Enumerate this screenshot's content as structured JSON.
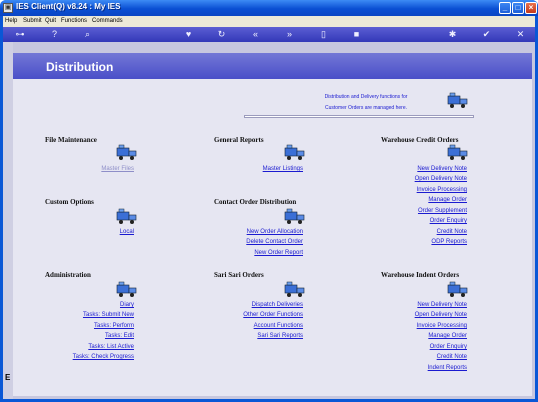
{
  "window": {
    "title": "IES Client(Q) v8.24 : My IES"
  },
  "menubar": {
    "items": [
      "Help",
      "Submit",
      "Quit",
      "Functions",
      "Commands"
    ]
  },
  "toolbar": {
    "icons": [
      "key-icon",
      "help-icon",
      "search-icon",
      "heart-icon",
      "refresh-icon",
      "rewind-icon",
      "fast-forward-icon",
      "document-icon",
      "stop-icon",
      "world-icon",
      "check-icon",
      "close-icon"
    ]
  },
  "header": {
    "title": "Distribution"
  },
  "intro": {
    "line1": "Distribution and Delivery functions for",
    "line2": "Customer Orders are managed here."
  },
  "sections": {
    "file_maintenance": {
      "title": "File Maintenance",
      "links": [
        "Master Files"
      ]
    },
    "general_reports": {
      "title": "General Reports",
      "links": [
        "Master Listings"
      ]
    },
    "warehouse_credit": {
      "title": "Warehouse Credit Orders",
      "links": [
        "New Delivery Note",
        "Open Delivery Note",
        "Invoice Processing",
        "Manage Order",
        "Order Supplement",
        "Order Enquiry",
        "Credit Note",
        "ODP Reports"
      ]
    },
    "custom_options": {
      "title": "Custom Options",
      "links": [
        "Local"
      ]
    },
    "contact_order": {
      "title": "Contact Order Distribution",
      "links": [
        "New Order Allocation",
        "Delete Contact Order",
        "New Order Report"
      ]
    },
    "administration": {
      "title": "Administration",
      "links": [
        "Diary",
        "Tasks: Submit New",
        "Tasks: Perform",
        "Tasks: Edit",
        "Tasks: List Active",
        "Tasks: Check Progress"
      ]
    },
    "sari_sari": {
      "title": "Sari Sari Orders",
      "links": [
        "Dispatch Deliveries",
        "Other Order Functions",
        "Account Functions",
        "Sari Sari Reports"
      ]
    },
    "warehouse_indent": {
      "title": "Warehouse Indent Orders",
      "links": [
        "New Delivery Note",
        "Open Delivery Note",
        "Invoice Processing",
        "Manage Order",
        "Order Enquiry",
        "Credit Note",
        "Indent Reports"
      ]
    }
  },
  "leftbar": {
    "mark": "E"
  },
  "colors": {
    "link": "#1a1ad0",
    "link_muted": "#8e8ec8",
    "header": "#4a4fc8",
    "panel": "#e6e6f2"
  }
}
